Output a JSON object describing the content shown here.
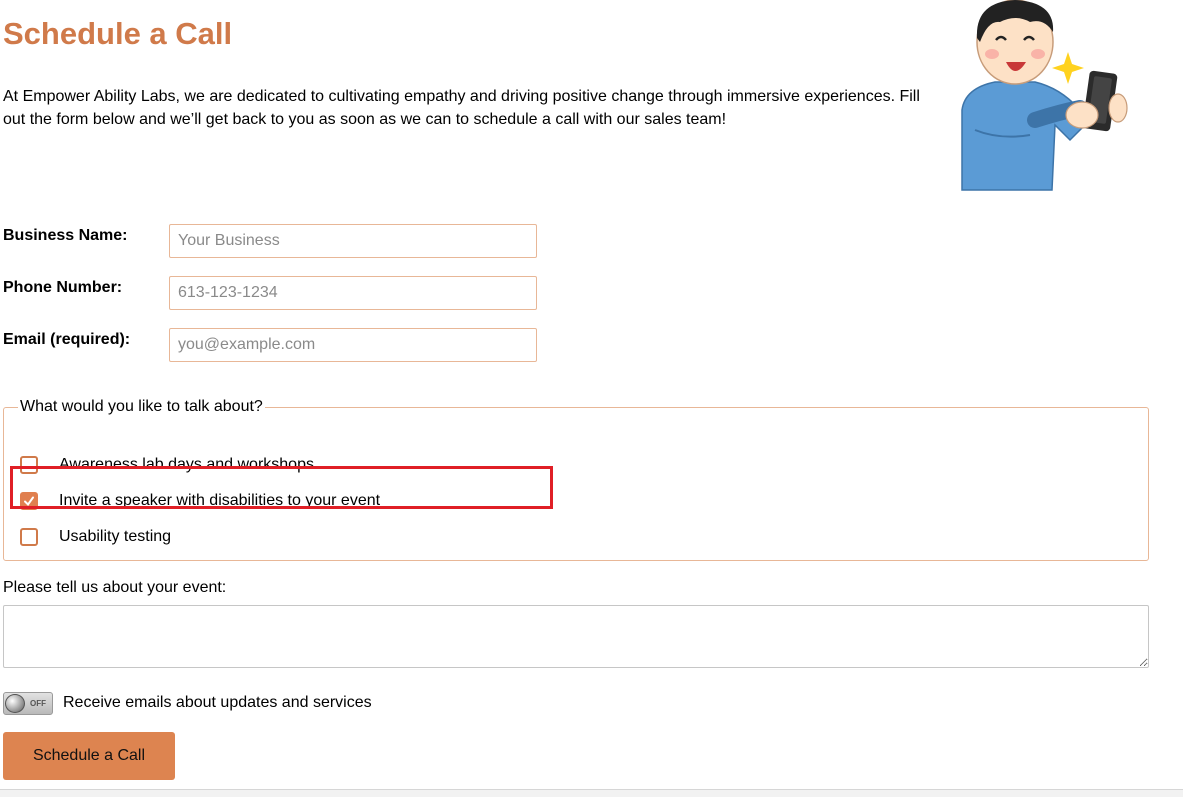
{
  "page": {
    "title": "Schedule a Call",
    "intro": "At Empower Ability Labs, we are dedicated to cultivating empathy and driving positive change through immersive experiences. Fill out the form below and we’ll get back to you as soon as we can to schedule a call with our sales team!"
  },
  "form": {
    "business_name": {
      "label": "Business Name:",
      "placeholder": "Your Business",
      "value": ""
    },
    "phone": {
      "label": "Phone Number:",
      "placeholder": "613-123-1234",
      "value": ""
    },
    "email": {
      "label": "Email (required):",
      "placeholder": "you@example.com",
      "value": ""
    },
    "topics": {
      "legend": "What would you like to talk about?",
      "options": [
        {
          "label": "Awareness lab days and workshops",
          "checked": false
        },
        {
          "label": "Invite a speaker with disabilities to your event",
          "checked": true
        },
        {
          "label": "Usability testing",
          "checked": false
        }
      ]
    },
    "event": {
      "label": "Please tell us about your event:",
      "value": ""
    },
    "updates_toggle": {
      "label": "Receive emails about updates and services",
      "state_text": "OFF",
      "on": false
    },
    "submit_label": "Schedule a Call"
  },
  "colors": {
    "accent": "#d07a4a",
    "button": "#dd8450",
    "checkbox_checked": "#e07f4f",
    "highlight": "#e01f26"
  },
  "illustration": {
    "icon": "person-taking-phone-photo-illustration"
  }
}
